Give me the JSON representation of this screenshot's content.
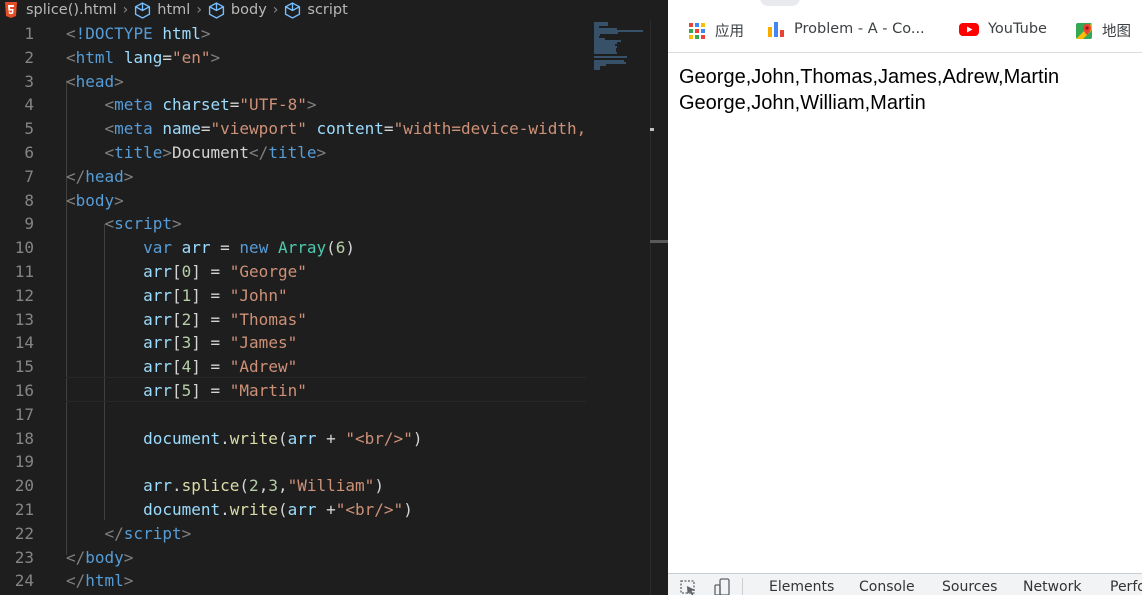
{
  "editor": {
    "breadcrumb": {
      "file": "splice().html",
      "items": [
        "html",
        "body",
        "script"
      ]
    },
    "lines": [
      {
        "n": "1",
        "parts": [
          {
            "c": "p",
            "t": "<"
          },
          {
            "c": "t",
            "t": "!DOCTYPE"
          },
          {
            "c": "w",
            "t": " "
          },
          {
            "c": "a",
            "t": "html"
          },
          {
            "c": "p",
            "t": ">"
          }
        ]
      },
      {
        "n": "2",
        "parts": [
          {
            "c": "p",
            "t": "<"
          },
          {
            "c": "t",
            "t": "html"
          },
          {
            "c": "w",
            "t": " "
          },
          {
            "c": "a",
            "t": "lang"
          },
          {
            "c": "w",
            "t": "="
          },
          {
            "c": "s",
            "t": "\"en\""
          },
          {
            "c": "p",
            "t": ">"
          }
        ]
      },
      {
        "n": "3",
        "parts": [
          {
            "c": "p",
            "t": "<"
          },
          {
            "c": "t",
            "t": "head"
          },
          {
            "c": "p",
            "t": ">"
          }
        ]
      },
      {
        "n": "4",
        "parts": [
          {
            "c": "w",
            "t": "    "
          },
          {
            "c": "p",
            "t": "<"
          },
          {
            "c": "t",
            "t": "meta"
          },
          {
            "c": "w",
            "t": " "
          },
          {
            "c": "a",
            "t": "charset"
          },
          {
            "c": "w",
            "t": "="
          },
          {
            "c": "s",
            "t": "\"UTF-8\""
          },
          {
            "c": "p",
            "t": ">"
          }
        ]
      },
      {
        "n": "5",
        "parts": [
          {
            "c": "w",
            "t": "    "
          },
          {
            "c": "p",
            "t": "<"
          },
          {
            "c": "t",
            "t": "meta"
          },
          {
            "c": "w",
            "t": " "
          },
          {
            "c": "a",
            "t": "name"
          },
          {
            "c": "w",
            "t": "="
          },
          {
            "c": "s",
            "t": "\"viewport\""
          },
          {
            "c": "w",
            "t": " "
          },
          {
            "c": "a",
            "t": "content"
          },
          {
            "c": "w",
            "t": "="
          },
          {
            "c": "s",
            "t": "\"width=device-width,"
          }
        ]
      },
      {
        "n": "6",
        "parts": [
          {
            "c": "w",
            "t": "    "
          },
          {
            "c": "p",
            "t": "<"
          },
          {
            "c": "t",
            "t": "title"
          },
          {
            "c": "p",
            "t": ">"
          },
          {
            "c": "w",
            "t": "Document"
          },
          {
            "c": "p",
            "t": "</"
          },
          {
            "c": "t",
            "t": "title"
          },
          {
            "c": "p",
            "t": ">"
          }
        ]
      },
      {
        "n": "7",
        "parts": [
          {
            "c": "p",
            "t": "</"
          },
          {
            "c": "t",
            "t": "head"
          },
          {
            "c": "p",
            "t": ">"
          }
        ]
      },
      {
        "n": "8",
        "parts": [
          {
            "c": "p",
            "t": "<"
          },
          {
            "c": "t",
            "t": "body"
          },
          {
            "c": "p",
            "t": ">"
          }
        ]
      },
      {
        "n": "9",
        "parts": [
          {
            "c": "w",
            "t": "    "
          },
          {
            "c": "p",
            "t": "<"
          },
          {
            "c": "t",
            "t": "script"
          },
          {
            "c": "p",
            "t": ">"
          }
        ]
      },
      {
        "n": "10",
        "parts": [
          {
            "c": "w",
            "t": "        "
          },
          {
            "c": "t",
            "t": "var"
          },
          {
            "c": "w",
            "t": " "
          },
          {
            "c": "a",
            "t": "arr"
          },
          {
            "c": "w",
            "t": " = "
          },
          {
            "c": "t",
            "t": "new"
          },
          {
            "c": "w",
            "t": " "
          },
          {
            "c": "c",
            "t": "Array"
          },
          {
            "c": "w",
            "t": "("
          },
          {
            "c": "n",
            "t": "6"
          },
          {
            "c": "w",
            "t": ")"
          }
        ]
      },
      {
        "n": "11",
        "parts": [
          {
            "c": "w",
            "t": "        "
          },
          {
            "c": "a",
            "t": "arr"
          },
          {
            "c": "w",
            "t": "["
          },
          {
            "c": "n",
            "t": "0"
          },
          {
            "c": "w",
            "t": "] = "
          },
          {
            "c": "s",
            "t": "\"George\""
          }
        ]
      },
      {
        "n": "12",
        "parts": [
          {
            "c": "w",
            "t": "        "
          },
          {
            "c": "a",
            "t": "arr"
          },
          {
            "c": "w",
            "t": "["
          },
          {
            "c": "n",
            "t": "1"
          },
          {
            "c": "w",
            "t": "] = "
          },
          {
            "c": "s",
            "t": "\"John\""
          }
        ]
      },
      {
        "n": "13",
        "parts": [
          {
            "c": "w",
            "t": "        "
          },
          {
            "c": "a",
            "t": "arr"
          },
          {
            "c": "w",
            "t": "["
          },
          {
            "c": "n",
            "t": "2"
          },
          {
            "c": "w",
            "t": "] = "
          },
          {
            "c": "s",
            "t": "\"Thomas\""
          }
        ]
      },
      {
        "n": "14",
        "parts": [
          {
            "c": "w",
            "t": "        "
          },
          {
            "c": "a",
            "t": "arr"
          },
          {
            "c": "w",
            "t": "["
          },
          {
            "c": "n",
            "t": "3"
          },
          {
            "c": "w",
            "t": "] = "
          },
          {
            "c": "s",
            "t": "\"James\""
          }
        ]
      },
      {
        "n": "15",
        "parts": [
          {
            "c": "w",
            "t": "        "
          },
          {
            "c": "a",
            "t": "arr"
          },
          {
            "c": "w",
            "t": "["
          },
          {
            "c": "n",
            "t": "4"
          },
          {
            "c": "w",
            "t": "] = "
          },
          {
            "c": "s",
            "t": "\"Adrew\""
          }
        ]
      },
      {
        "n": "16",
        "parts": [
          {
            "c": "w",
            "t": "        "
          },
          {
            "c": "a",
            "t": "arr"
          },
          {
            "c": "w",
            "t": "["
          },
          {
            "c": "n",
            "t": "5"
          },
          {
            "c": "w",
            "t": "] = "
          },
          {
            "c": "s",
            "t": "\"Martin\""
          }
        ]
      },
      {
        "n": "17",
        "parts": []
      },
      {
        "n": "18",
        "parts": [
          {
            "c": "w",
            "t": "        "
          },
          {
            "c": "a",
            "t": "document"
          },
          {
            "c": "w",
            "t": "."
          },
          {
            "c": "f",
            "t": "write"
          },
          {
            "c": "w",
            "t": "("
          },
          {
            "c": "a",
            "t": "arr"
          },
          {
            "c": "w",
            "t": " + "
          },
          {
            "c": "s",
            "t": "\"<br/>\""
          },
          {
            "c": "w",
            "t": ")"
          }
        ]
      },
      {
        "n": "19",
        "parts": []
      },
      {
        "n": "20",
        "parts": [
          {
            "c": "w",
            "t": "        "
          },
          {
            "c": "a",
            "t": "arr"
          },
          {
            "c": "w",
            "t": "."
          },
          {
            "c": "f",
            "t": "splice"
          },
          {
            "c": "w",
            "t": "("
          },
          {
            "c": "n",
            "t": "2"
          },
          {
            "c": "w",
            "t": ","
          },
          {
            "c": "n",
            "t": "3"
          },
          {
            "c": "w",
            "t": ","
          },
          {
            "c": "s",
            "t": "\"William\""
          },
          {
            "c": "w",
            "t": ")"
          }
        ]
      },
      {
        "n": "21",
        "parts": [
          {
            "c": "w",
            "t": "        "
          },
          {
            "c": "a",
            "t": "document"
          },
          {
            "c": "w",
            "t": "."
          },
          {
            "c": "f",
            "t": "write"
          },
          {
            "c": "w",
            "t": "("
          },
          {
            "c": "a",
            "t": "arr"
          },
          {
            "c": "w",
            "t": " +"
          },
          {
            "c": "s",
            "t": "\"<br/>\""
          },
          {
            "c": "w",
            "t": ")"
          }
        ]
      },
      {
        "n": "22",
        "parts": [
          {
            "c": "w",
            "t": "    "
          },
          {
            "c": "p",
            "t": "</"
          },
          {
            "c": "t",
            "t": "script"
          },
          {
            "c": "p",
            "t": ">"
          }
        ]
      },
      {
        "n": "23",
        "parts": [
          {
            "c": "p",
            "t": "</"
          },
          {
            "c": "t",
            "t": "body"
          },
          {
            "c": "p",
            "t": ">"
          }
        ]
      },
      {
        "n": "24",
        "parts": [
          {
            "c": "p",
            "t": "</"
          },
          {
            "c": "t",
            "t": "html"
          },
          {
            "c": "p",
            "t": ">"
          }
        ]
      }
    ],
    "colors": {
      "tag": "#569cd6",
      "attr": "#9cdcfe",
      "string": "#ce9178",
      "number": "#b5cea8",
      "func": "#dcdcaa",
      "class": "#4ec9b0"
    }
  },
  "browser": {
    "bookmarks": [
      {
        "label": "应用",
        "icon": "apps-grid-icon"
      },
      {
        "label": "Problem - A - Co...",
        "icon": "bar-chart-icon"
      },
      {
        "label": "YouTube",
        "icon": "youtube-icon"
      },
      {
        "label": "地图",
        "icon": "maps-icon"
      }
    ],
    "output": [
      "George,John,Thomas,James,Adrew,Martin",
      "George,John,William,Martin"
    ],
    "devtools_tabs": [
      "Elements",
      "Console",
      "Sources",
      "Network",
      "Perfo"
    ]
  }
}
